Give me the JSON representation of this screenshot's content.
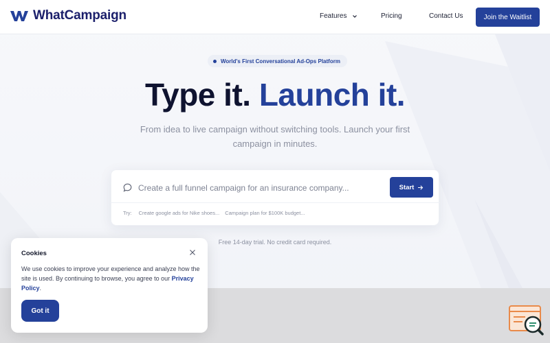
{
  "header": {
    "logo_text": "WhatCampaign",
    "nav": {
      "features": "Features",
      "pricing": "Pricing",
      "contact": "Contact Us"
    },
    "cta": "Join the Waitlist"
  },
  "hero": {
    "badge": "World's First Conversational Ad-Ops Platform",
    "headline_part1": "Type it.",
    "headline_part2": "Launch it.",
    "subline": "From idea to live campaign without switching tools. Launch your first campaign in minutes."
  },
  "prompt": {
    "placeholder": "Create a full funnel campaign for an insurance company...",
    "value": "",
    "start_label": "Start",
    "try_label": "Try:",
    "suggestions": [
      "Create google ads for Nike shoes...",
      "Campaign plan for $100K budget..."
    ]
  },
  "trial_note": "Free 14-day trial. No credit card required.",
  "cookie": {
    "title": "Cookies",
    "text": "We use cookies to improve your experience and analyze how the site is used. By continuing to browse, you agree to our",
    "link": "Privacy Policy",
    "link_suffix": ".",
    "button": "Got it"
  },
  "colors": {
    "brand_blue": "#24419a",
    "headline_dark": "#0f1330",
    "widget_orange": "#e98a4a"
  },
  "icons": {
    "logo": "logo-w-icon",
    "chevron": "chevron-down-icon",
    "chat": "chat-bubble-icon",
    "arrow": "arrow-right-icon",
    "close": "close-icon",
    "widget": "support-search-icon"
  }
}
